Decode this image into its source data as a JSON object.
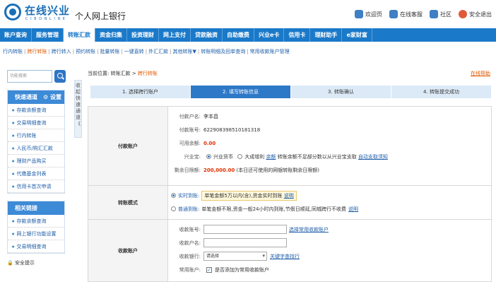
{
  "header": {
    "brand": "在线兴业",
    "brand_sub": "C I B O N L I N E",
    "bank_name": "个人网上银行",
    "links": [
      {
        "label": "欢迎页",
        "icon": "home-icon"
      },
      {
        "label": "在线客服",
        "icon": "service-icon"
      },
      {
        "label": "社区",
        "icon": "community-icon"
      },
      {
        "label": "安全退出",
        "icon": "power-icon"
      }
    ]
  },
  "nav": [
    "账户查询",
    "服务管理",
    "转账汇款",
    "资金归集",
    "投资理财",
    "网上支付",
    "贷款融资",
    "自助缴费",
    "兴业e卡",
    "信用卡",
    "理财助手",
    "e家财富"
  ],
  "nav_active": 2,
  "subnav": [
    "行内转账",
    "跨行转账",
    "跨行转入",
    "预约转账",
    "批量转账",
    "一键直转",
    "外汇汇款",
    "其他转账▼",
    "转账明细及回单查询",
    "常用收款账户管理"
  ],
  "subnav_active": 1,
  "sidebar": {
    "search_placeholder": "功能搜索",
    "quick_title": "快速通道",
    "settings_label": "设置",
    "quick_items": [
      "存款余额查询",
      "交易明细查询",
      "行内转账",
      "人民币/购汇汇款",
      "理财产品购买",
      "代缴基金列表",
      "信用卡首次申请"
    ],
    "collapse_label": "收起快速通道《",
    "related_title": "相关链接",
    "related_items": [
      "存款余额查询",
      "网上银行功能设置",
      "交易明细查询"
    ],
    "security_label": "安全提示"
  },
  "breadcrumb": {
    "prefix": "当前位置:",
    "parent": "转账汇款",
    "current": "跨行转账"
  },
  "help_label": "在线帮助",
  "steps": [
    "1. 选择跨行账户",
    "2. 填写转账信息",
    "3. 转账确认",
    "4. 转账提交成功"
  ],
  "steps_active": 1,
  "payer": {
    "title": "付款账户",
    "name_label": "付款户名:",
    "name": "李本昌",
    "account_label": "付款账号:",
    "account": "622908398510181318",
    "balance_label": "可用余额:",
    "balance": "0.00",
    "currency_label": "兴业宝:",
    "option1": "兴业货币",
    "option2": "大成增利",
    "option2_link": "余额",
    "option2_note": "转账余额不足部分数以从兴业宝支取",
    "auto_link": "自动支取须知",
    "limit_label": "剩余日限额:",
    "limit": "200,000.00",
    "limit_note": "(本日还可使用的网银转账剩余日限额)"
  },
  "mode": {
    "title": "转账模式",
    "realtime_label": "实时到账:",
    "realtime_text": "单笔金额5万以内(含),资金实时到账",
    "realtime_link": "说明",
    "normal_label": "普通到账:",
    "normal_text": "单笔金额不限,资金一般24小时内到账,节假日顺延,同城跨行不收费",
    "normal_link": "说明"
  },
  "payee": {
    "title": "收款账户",
    "account_label": "收款账号:",
    "account_link": "选择常用收款账户",
    "name_label": "收款户名:",
    "bank_label": "收款银行:",
    "bank_value": "请选择",
    "bank_link": "关键字查找行",
    "common_label": "常用账户:",
    "common_text": "是否添加为常用收款账户"
  }
}
